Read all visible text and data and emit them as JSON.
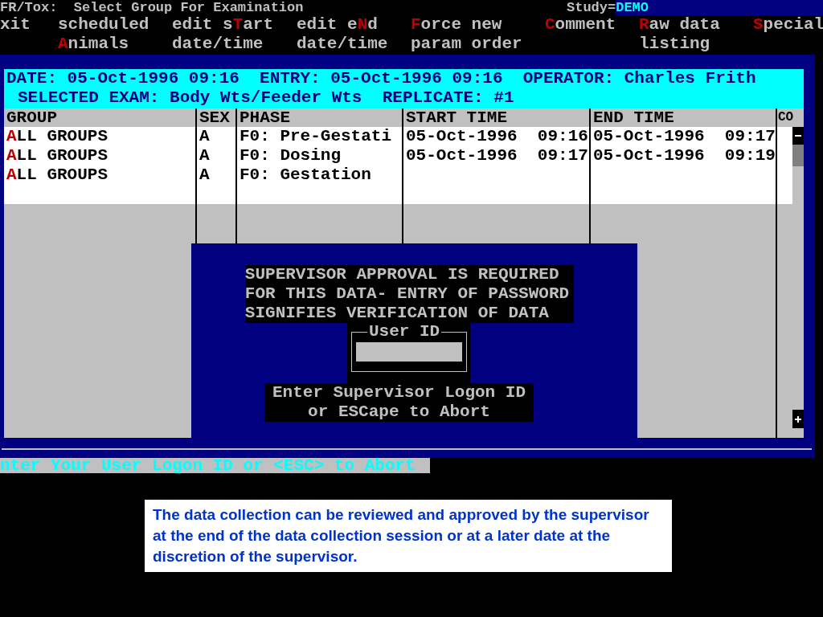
{
  "title_bar": {
    "title": "FR/Tox:  Select Group For Examination",
    "study_label": "Study=",
    "study_value": "DEMO"
  },
  "menu": [
    {
      "lines": [
        [
          {
            "text": "xit",
            "hotkey": false
          }
        ]
      ]
    },
    {
      "lines": [
        [
          {
            "text": "scheduled",
            "hotkey": false
          }
        ],
        [
          {
            "text": "A",
            "hotkey": true
          },
          {
            "text": "nimals",
            "hotkey": false
          }
        ]
      ]
    },
    {
      "lines": [
        [
          {
            "text": "edit s",
            "hotkey": false
          },
          {
            "text": "T",
            "hotkey": true
          },
          {
            "text": "art",
            "hotkey": false
          }
        ],
        [
          {
            "text": "date/time",
            "hotkey": false
          }
        ]
      ]
    },
    {
      "lines": [
        [
          {
            "text": "edit e",
            "hotkey": false
          },
          {
            "text": "N",
            "hotkey": true
          },
          {
            "text": "d",
            "hotkey": false
          }
        ],
        [
          {
            "text": "date/time",
            "hotkey": false
          }
        ]
      ]
    },
    {
      "lines": [
        [
          {
            "text": "F",
            "hotkey": true
          },
          {
            "text": "orce new",
            "hotkey": false
          }
        ],
        [
          {
            "text": "param order",
            "hotkey": false
          }
        ]
      ]
    },
    {
      "lines": [
        [
          {
            "text": "C",
            "hotkey": true
          },
          {
            "text": "omment",
            "hotkey": false
          }
        ]
      ]
    },
    {
      "lines": [
        [
          {
            "text": "R",
            "hotkey": true
          },
          {
            "text": "aw data",
            "hotkey": false
          }
        ],
        [
          {
            "text": "listing",
            "hotkey": false
          }
        ]
      ]
    },
    {
      "lines": [
        [
          {
            "text": "S",
            "hotkey": true
          },
          {
            "text": "pecial",
            "hotkey": false
          }
        ]
      ]
    }
  ],
  "info_lines": [
    "DATE: 05-Oct-1996 09:16  ENTRY: 05-Oct-1996 09:16  OPERATOR: Charles Frith",
    "SELECTED EXAM: Body Wts/Feeder Wts  REPLICATE: #1"
  ],
  "table": {
    "columns": [
      "GROUP",
      "SEX",
      "PHASE",
      "START TIME",
      "END TIME",
      "CO"
    ],
    "rows": [
      {
        "group": [
          {
            "text": "A",
            "hotkey": true
          },
          {
            "text": "LL GROUPS",
            "hotkey": false
          }
        ],
        "sex": "A",
        "phase": "F0: Pre-Gestati",
        "start": "05-Oct-1996  09:16",
        "end": "05-Oct-1996  09:17"
      },
      {
        "group": [
          {
            "text": "A",
            "hotkey": true
          },
          {
            "text": "LL GROUPS",
            "hotkey": false
          }
        ],
        "sex": "A",
        "phase": "F0: Dosing",
        "start": "05-Oct-1996  09:17",
        "end": "05-Oct-1996  09:19"
      },
      {
        "group": [
          {
            "text": "A",
            "hotkey": true
          },
          {
            "text": "LL GROUPS",
            "hotkey": false
          }
        ],
        "sex": "A",
        "phase": "F0: Gestation"
      }
    ]
  },
  "dialog": {
    "message_lines": [
      "SUPERVISOR APPROVAL IS REQUIRED",
      "FOR THIS DATA- ENTRY OF PASSWORD",
      "SIGNIFIES VERIFICATION OF DATA"
    ],
    "field_label": "User ID",
    "prompt_lines": [
      "Enter Supervisor Logon ID",
      "or ESCape to Abort"
    ]
  },
  "status_line": "nter Your User Logon ID or <ESC> to Abort",
  "caption": "The data collection can be reviewed and approved by the supervisor at the end of the data collection session or at a later date at the discretion of the supervisor."
}
